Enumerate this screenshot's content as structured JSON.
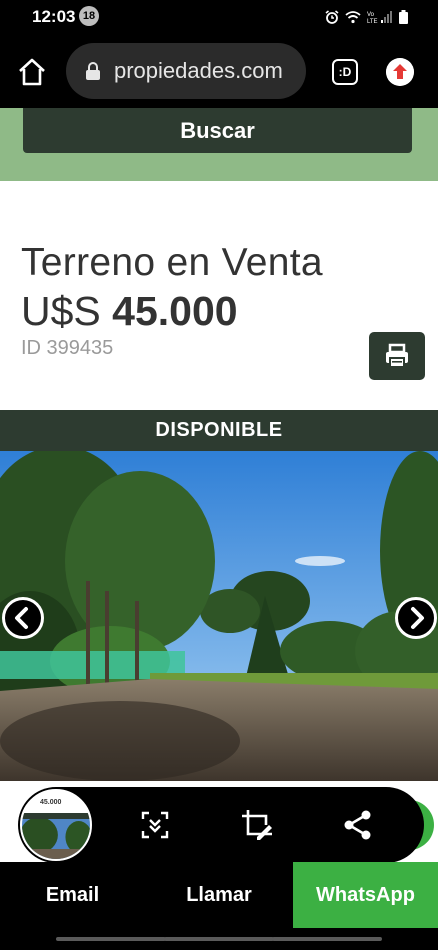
{
  "status_bar": {
    "time": "12:03",
    "notification_count": "18",
    "icons": [
      "alarm-icon",
      "wifi-icon",
      "lte-signal-icon",
      "battery-icon"
    ]
  },
  "browser": {
    "url": "propiedades.com",
    "tab_icon_label": ":D",
    "icons": [
      "home-icon",
      "lock-icon",
      "extension-upload-icon"
    ]
  },
  "search": {
    "button_label": "Buscar"
  },
  "listing": {
    "title": "Terreno en Venta",
    "price_currency": "U$S",
    "price_value": "45.000",
    "id_label": "ID 399435",
    "status": "DISPONIBLE"
  },
  "thumbnail": {
    "price_text": "45.000"
  },
  "contact": {
    "email_label": "Email",
    "call_label": "Llamar",
    "whatsapp_label": "WhatsApp"
  },
  "colors": {
    "brand_dark_green": "#2d3b30",
    "search_band_green": "#8fba87",
    "whatsapp_green": "#3cb043"
  }
}
